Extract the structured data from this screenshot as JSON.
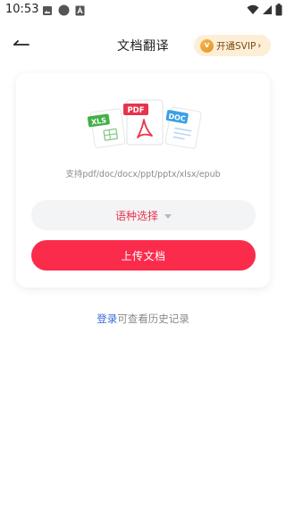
{
  "status_bar": {
    "time": "10:53",
    "icons": [
      "image-icon",
      "circle-icon",
      "font-icon",
      "wifi-icon",
      "signal-icon",
      "battery-icon"
    ]
  },
  "header": {
    "title": "文档翻译",
    "back_icon": "back-arrow-icon",
    "vip": {
      "badge": "v",
      "label": "开通SVIP",
      "chevron": "›"
    }
  },
  "card": {
    "illustration": {
      "xls_label": "XLS",
      "pdf_label": "PDF",
      "doc_label": "DOC"
    },
    "formats_text": "支持pdf/doc/docx/ppt/pptx/xlsx/epub",
    "language_select_label": "语种选择",
    "upload_button_label": "上传文档"
  },
  "login_hint": {
    "link_text": "登录",
    "rest_text": "可查看历史记录"
  },
  "colors": {
    "accent": "#fb2b4c",
    "link": "#3b6ad8",
    "vip_bg": "#fdeed6",
    "xls_green": "#44b046",
    "pdf_red": "#e8334c",
    "doc_blue": "#3aa0e6"
  }
}
